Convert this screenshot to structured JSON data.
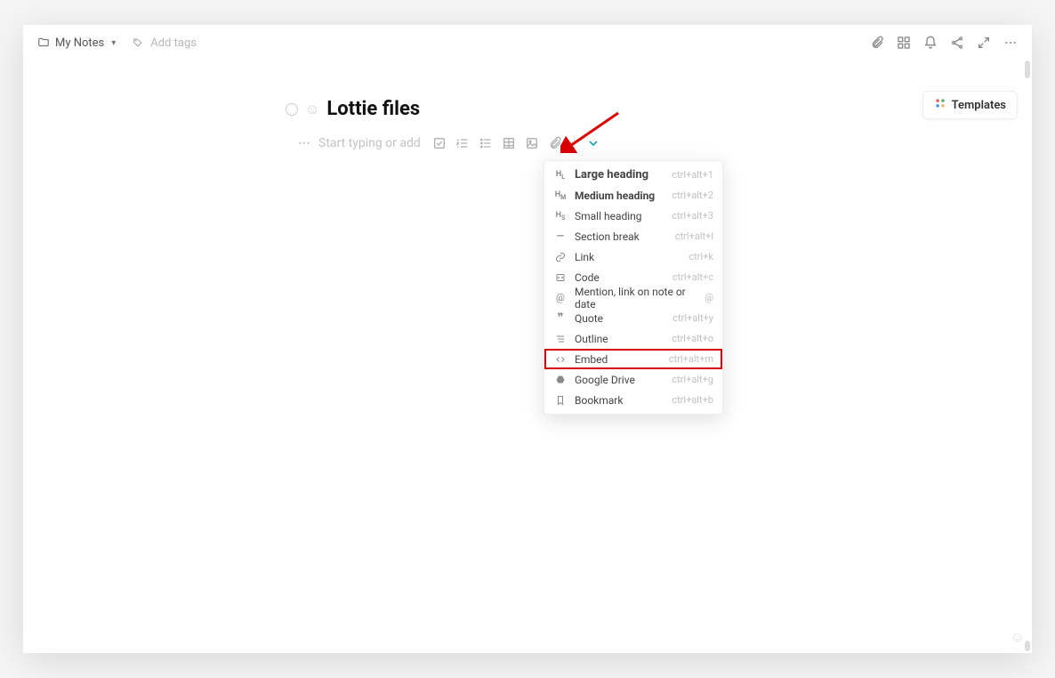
{
  "topbar": {
    "breadcrumb": "My Notes",
    "add_tags": "Add tags"
  },
  "title": "Lottie files",
  "editor": {
    "placeholder": "Start typing or add"
  },
  "templates_button": "Templates",
  "dropdown": {
    "items": [
      {
        "icon": "H₁",
        "label": "Large heading",
        "shortcut": "ctrl+alt+1",
        "class": "h1"
      },
      {
        "icon": "H₂",
        "label": "Medium heading",
        "shortcut": "ctrl+alt+2",
        "class": "h2"
      },
      {
        "icon": "H₃",
        "label": "Small heading",
        "shortcut": "ctrl+alt+3",
        "class": ""
      },
      {
        "icon": "—",
        "label": "Section break",
        "shortcut": "ctrl+alt+l",
        "class": ""
      },
      {
        "icon": "🔗",
        "label": "Link",
        "shortcut": "ctrl+k",
        "class": ""
      },
      {
        "icon": "{}",
        "label": "Code",
        "shortcut": "ctrl+alt+c",
        "class": ""
      },
      {
        "icon": "@",
        "label": "Mention, link on note or date",
        "shortcut": "@",
        "class": ""
      },
      {
        "icon": "❝",
        "label": "Quote",
        "shortcut": "ctrl+alt+y",
        "class": ""
      },
      {
        "icon": "≡",
        "label": "Outline",
        "shortcut": "ctrl+alt+o",
        "class": ""
      },
      {
        "icon": "<>",
        "label": "Embed",
        "shortcut": "ctrl+alt+m",
        "class": "highlighted"
      },
      {
        "icon": "gd",
        "label": "Google Drive",
        "shortcut": "ctrl+alt+g",
        "class": ""
      },
      {
        "icon": "bm",
        "label": "Bookmark",
        "shortcut": "ctrl+alt+b",
        "class": ""
      }
    ]
  }
}
